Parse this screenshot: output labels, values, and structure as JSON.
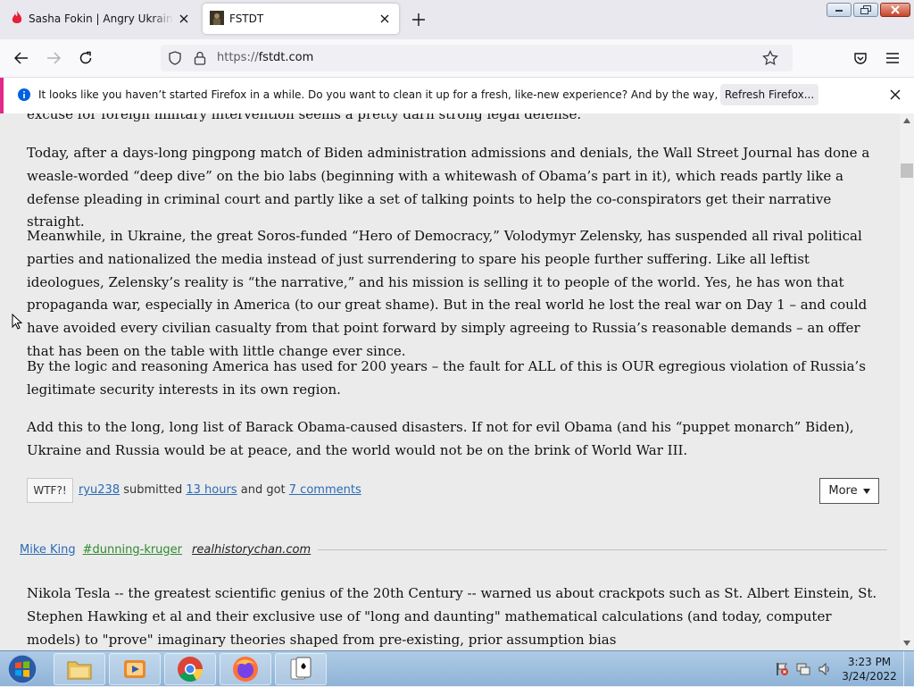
{
  "colors": {
    "accent": "#e0298a",
    "link": "#2a6bb5",
    "tag": "#2e8b2e",
    "info": "#0060df"
  },
  "browser": {
    "tabs": [
      {
        "title": "Sasha Fokin | Angry Ukrainian K",
        "active": false,
        "icon": "flame-icon"
      },
      {
        "title": "FSTDT",
        "active": true,
        "icon": "fstdt-favicon"
      }
    ],
    "url_scheme": "https://",
    "url_host": "fstdt.com",
    "notification": {
      "message": "It looks like you haven’t started Firefox in a while. Do you want to clean it up for a fresh, like-new experience? And by the way, welcome back!",
      "button": "Refresh Firefox..."
    }
  },
  "post1": {
    "paragraphs": [
      "excuse for foreign military intervention seems a pretty darn strong legal defense.",
      "Today, after a days-long pingpong match of Biden administration admissions and denials, the Wall Street Journal has done a weasle-worded “deep dive” on the bio labs (beginning with a whitewash of Obama’s part in it), which reads partly like a defense pleading in criminal court and partly like a set of talking points to help the co-conspirators get their narrative straight.",
      "Meanwhile, in Ukraine, the great Soros-funded “Hero of Democracy,” Volodymyr Zelensky, has suspended all rival political parties and nationalized the media instead of just surrendering to spare his people further suffering. Like all leftist ideologues, Zelensky’s reality is “the narrative,” and his mission is selling it to people of the world. Yes, he has won that propaganda war, especially in America (to our great shame). But in the real world he lost the real war on Day 1 – and could have avoided every civilian casualty from that point forward by simply agreeing to Russia’s reasonable demands – an offer that has been on the table with little change ever since.",
      "By the logic and reasoning America has used for 200 years – the fault for ALL of this is OUR egregious violation of Russia’s legitimate security interests in its own region.",
      "Add this to the long, long list of Barack Obama-caused disasters. If not for evil Obama (and his “puppet monarch” Biden), Ukraine and Russia would be at peace, and the world would not be on the brink of World War III."
    ],
    "wtf_label": "WTF?!",
    "submitter": "ryu238",
    "submitted_word": "submitted",
    "time_ago": "13 hours",
    "and_got": "and got",
    "comments": "7 comments",
    "more_label": "More"
  },
  "post2": {
    "author": "Mike King",
    "tag": "#dunning-kruger",
    "source": "realhistorychan.com",
    "body": "Nikola Tesla -- the greatest scientific genius of the 20th Century -- warned us about crackpots such as St. Albert Einstein, St. Stephen Hawking et al and their exclusive use of \"long and daunting\" mathematical calculations (and today, computer models) to \"prove\" imaginary theories shaped from pre-existing, prior assumption bias"
  },
  "taskbar": {
    "time": "3:23 PM",
    "date": "3/24/2022",
    "apps": [
      "file-explorer-icon",
      "media-player-icon",
      "chrome-icon",
      "firefox-icon",
      "solitaire-icon"
    ]
  }
}
